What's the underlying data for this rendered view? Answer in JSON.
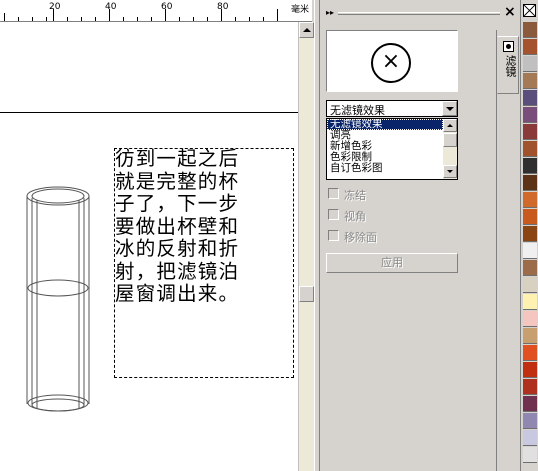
{
  "ruler": {
    "numbers": [
      "20",
      "40",
      "60",
      "80"
    ],
    "unit": "毫米"
  },
  "poem": {
    "lines": [
      "彷到一起之后",
      "就是完整的杯",
      "子了，下一步",
      "要做出杯壁和",
      "冰的反射和折",
      "射，把滤镜泊",
      "屋窗调出来。"
    ]
  },
  "docker": {
    "close_symbol": "×",
    "grip_symbol": "▸▸",
    "preview_symbol": "×",
    "tab_label": "滤镜",
    "lens_select_value": "无滤镜效果",
    "lens_options": [
      "无滤镜效果",
      "调亮",
      "新增色彩",
      "色彩限制",
      "自订色彩图"
    ],
    "selected_option": "无滤镜效果",
    "checkboxes": [
      "冻结",
      "视角",
      "移除面"
    ],
    "apply_label": "应用"
  },
  "palette": {
    "colors": [
      "#8b5a3c",
      "#a5522f",
      "#c0c0c0",
      "#a37a55",
      "#5a4e7d",
      "#7a4e7a",
      "#8b3a3a",
      "#a0522d",
      "#2f2f2f",
      "#5c3317",
      "#d06a2c",
      "#c85a1e",
      "#8b4513",
      "#f0f0f0",
      "#9c6b4a",
      "#d8d0c0",
      "#fff2b0",
      "#f5c6c0",
      "#c8a070",
      "#e05020",
      "#c03010",
      "#b03020",
      "#703050",
      "#9088b0",
      "#c8c8e0",
      "#e0e0e0"
    ]
  }
}
